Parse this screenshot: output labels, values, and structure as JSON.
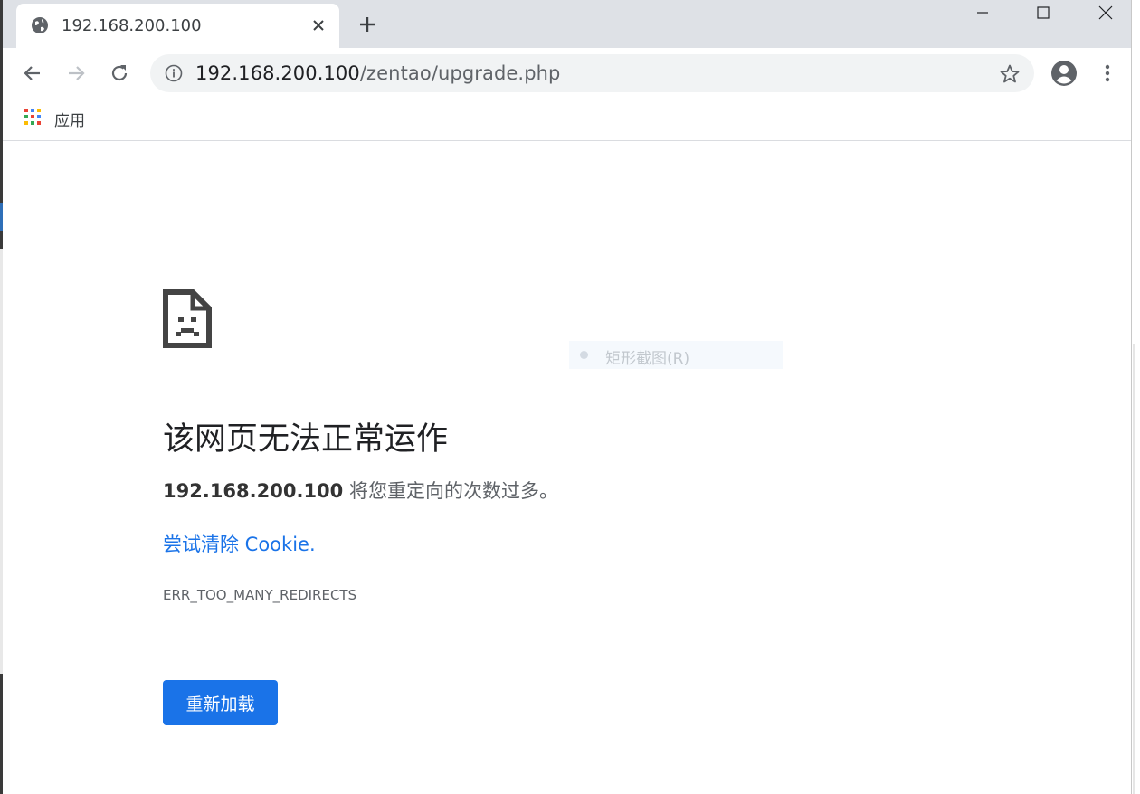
{
  "tab": {
    "title": "192.168.200.100",
    "favicon": "globe-icon"
  },
  "toolbar": {
    "url_host": "192.168.200.100",
    "url_path": "/zentao/upgrade.php"
  },
  "bookmarks": {
    "apps_label": "应用"
  },
  "error": {
    "icon": "sad-document-icon",
    "title": "该网页无法正常运作",
    "host": "192.168.200.100",
    "message": " 将您重定向的次数过多。",
    "link": "尝试清除 Cookie.",
    "code": "ERR_TOO_MANY_REDIRECTS",
    "reload_label": "重新加载"
  },
  "overlay": {
    "snip_label": "矩形截图(R)"
  },
  "colors": {
    "accent": "#1a73e8",
    "tabstrip": "#dee1e6",
    "omnibox": "#f1f3f4"
  }
}
